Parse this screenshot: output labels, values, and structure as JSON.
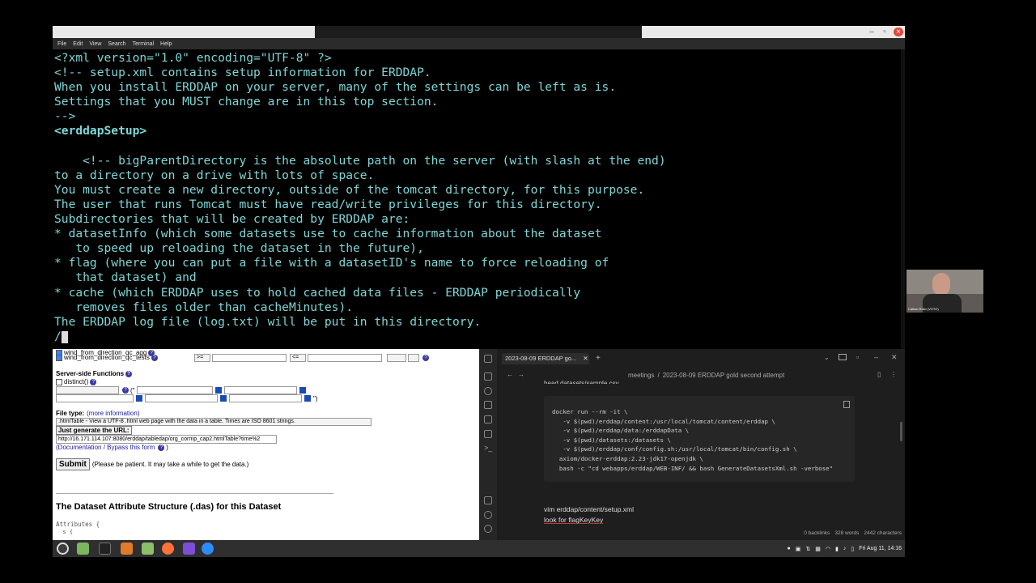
{
  "terminal": {
    "menu": [
      "File",
      "Edit",
      "View",
      "Search",
      "Terminal",
      "Help"
    ],
    "lines": [
      "<?xml version=\"1.0\" encoding=\"UTF-8\" ?>",
      "<!-- setup.xml contains setup information for ERDDAP.",
      "When you install ERDDAP on your server, many of the settings can be left as is.",
      "Settings that you MUST change are in this top section.",
      "-->",
      "<erddapSetup>",
      "",
      "    <!-- bigParentDirectory is the absolute path on the server (with slash at the end)",
      "to a directory on a drive with lots of space.",
      "You must create a new directory, outside of the tomcat directory, for this purpose.",
      "The user that runs Tomcat must have read/write privileges for this directory.",
      "Subdirectories that will be created by ERDDAP are:",
      "* datasetInfo (which some datasets use to cache information about the dataset",
      "   to speed up reloading the dataset in the future),",
      "* flag (where you can put a file with a datasetID's name to force reloading of",
      "   that dataset) and",
      "* cache (which ERDDAP uses to hold cached data files - ERDDAP periodically",
      "   removes files older than cacheMinutes).",
      "The ERDDAP log file (log.txt) will be put in this directory."
    ],
    "prompt": "/"
  },
  "browser": {
    "var_rows": [
      {
        "name": "wind_from_direction_qc_agg",
        "op1": ">=",
        "op2": "<="
      },
      {
        "name": "wind_from_direction_qc_tests",
        "op1": ">=",
        "op2": "<="
      }
    ],
    "server_side_functions": "Server-side Functions",
    "distinct": "distinct()",
    "paren_open": "(\"",
    "paren_close": "\")",
    "file_type_label": "File type:",
    "file_type_link": "(more information)",
    "file_type_value": ".htmlTable - View a UTF-8 .html web page with the data in a table. Times are ISO 8601 strings.",
    "generate_url_button": "Just generate the URL:",
    "url_value": "http://16.171.114.107:8080/erddap/tabledap/org_cormp_cap2.htmlTable?time%2",
    "doc_link": "(Documentation / Bypass this form",
    "doc_close": ")",
    "submit_label": "Submit",
    "submit_note": "(Please be patient. It may take a while to get the data.)",
    "das_heading": "The Dataset Attribute Structure (.das) for this Dataset",
    "attributes": "Attributes {",
    "attr_sub": "  s {"
  },
  "notes": {
    "tab_title": "2023-08-09 ERDDAP go...",
    "tab_close": "✕",
    "new_tab": "+",
    "breadcrumb_parent": "meetings",
    "breadcrumb_sep": "/",
    "breadcrumb_current": "2023-08-09 ERDDAP gold second attempt",
    "top_text": "head datasets/sample.csv",
    "code_lines": [
      "docker run --rm -it \\",
      "   -v $(pwd)/erddap/content:/usr/local/tomcat/content/erddap \\",
      "   -v $(pwd)/erddap/data:/erddapData \\",
      "   -v $(pwd)/datasets:/datasets \\",
      "   -v $(pwd)/erddap/conf/config.sh:/usr/local/tomcat/bin/config.sh \\",
      "  axiom/docker-erddap:2.23-jdk17-openjdk \\",
      "  bash -c \"cd webapps/erddap/WEB-INF/ && bash GenerateDatasetsXml.sh -verbose\""
    ],
    "line_vim": "vim erddap/content/setup.xml",
    "line_look": "look for flagKeyKey",
    "status_backlinks": "0 backlinks",
    "status_words": "328 words",
    "status_chars": "2442 characters"
  },
  "webcam": {
    "name": "Callum Rollo (VOTO)"
  },
  "taskbar": {
    "clock": "Fri Aug 11, 14:16"
  },
  "colors": {
    "terminal_text": "#7fd6d6",
    "accent_link": "#1a1aa6"
  }
}
